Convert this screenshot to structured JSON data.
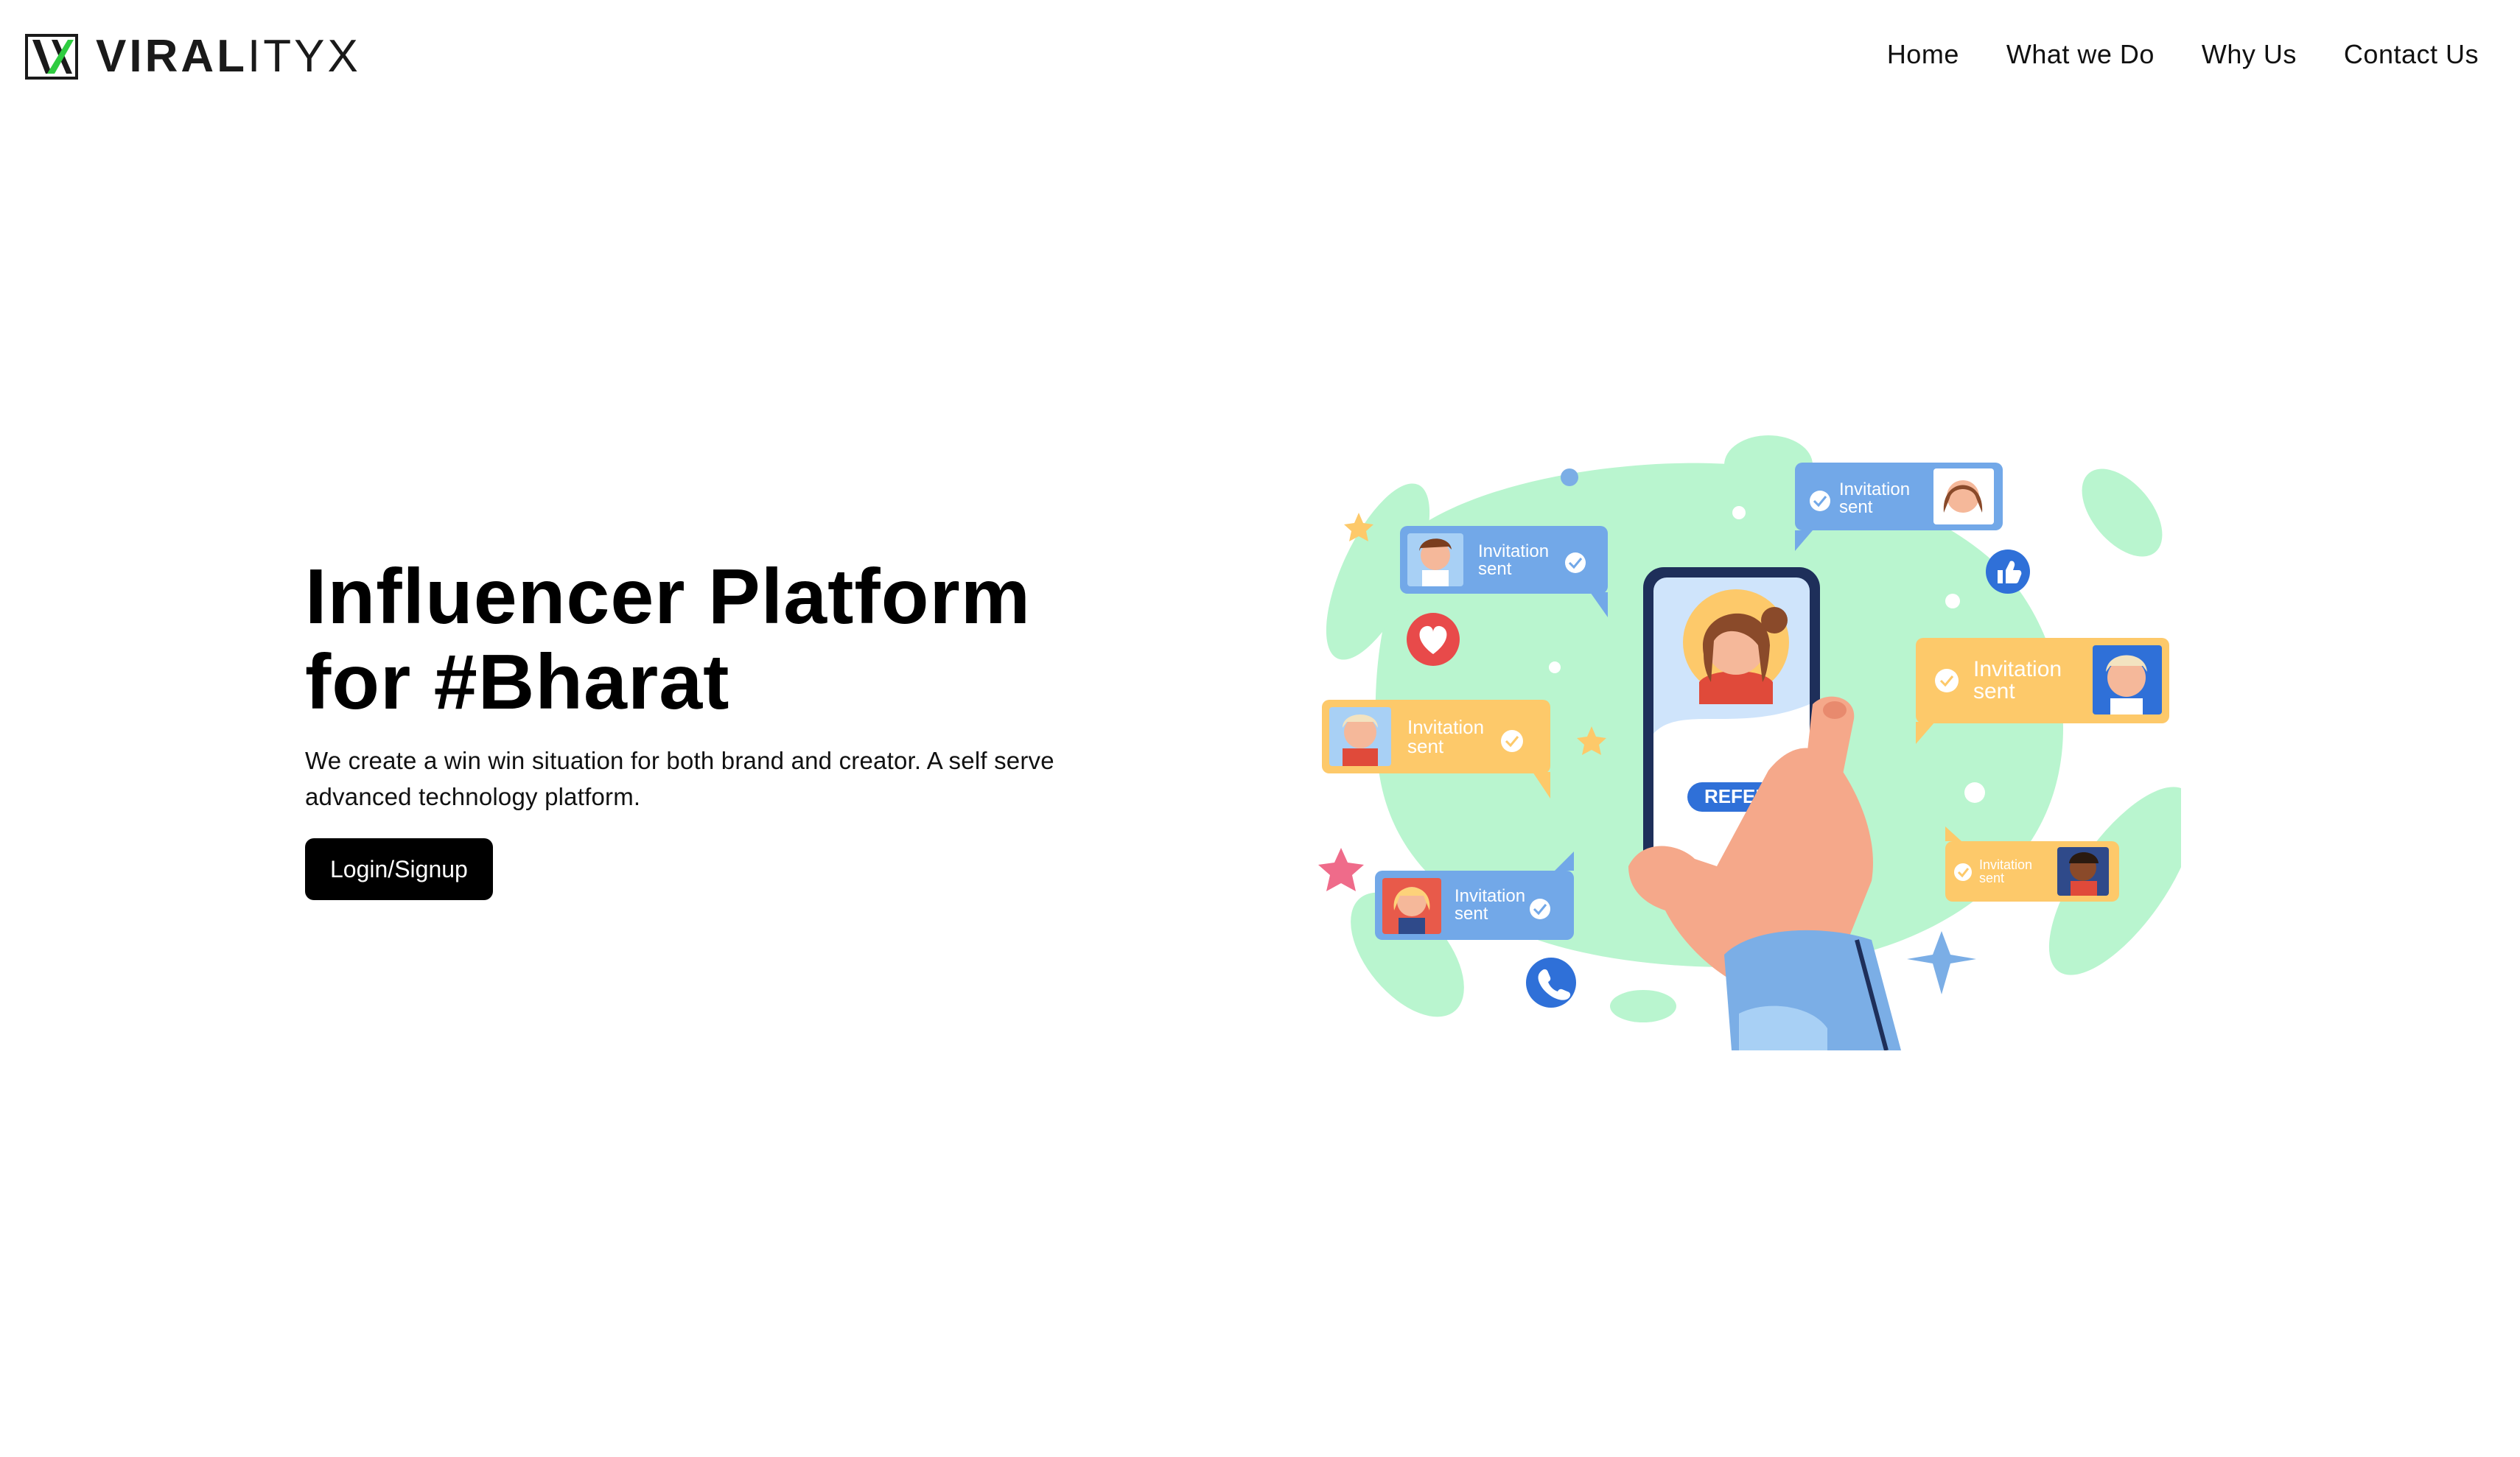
{
  "brand": {
    "name_bold": "VIRAL",
    "name_light": "ITYX",
    "logo_colors": {
      "frame": "#1a1a1a",
      "accent": "#2ecc40"
    }
  },
  "nav": {
    "items": [
      {
        "label": "Home"
      },
      {
        "label": "What we Do"
      },
      {
        "label": "Why Us"
      },
      {
        "label": "Contact Us"
      }
    ]
  },
  "hero": {
    "title_line1": "Influencer Platform",
    "title_line2": "for #Bharat",
    "subtitle": "We create a win win situation for both brand and creator. A self serve advanced technology platform.",
    "cta_label": "Login/Signup"
  },
  "illustration": {
    "refer_button": "REFER",
    "bubble_line1": "Invitation",
    "bubble_line2": "sent",
    "colors": {
      "blob": "#b9f5cf",
      "blue_bubble": "#72a8e8",
      "yellow_bubble": "#fdc96a",
      "phone": "#1e2f5a",
      "hand": "#f5a88a",
      "sleeve": "#7baee6",
      "heart": "#e84a4a",
      "icon_blue": "#2f70d8"
    }
  },
  "colors": {
    "text": "#000000",
    "cta_bg": "#000000",
    "cta_text": "#ffffff",
    "background": "#ffffff"
  }
}
